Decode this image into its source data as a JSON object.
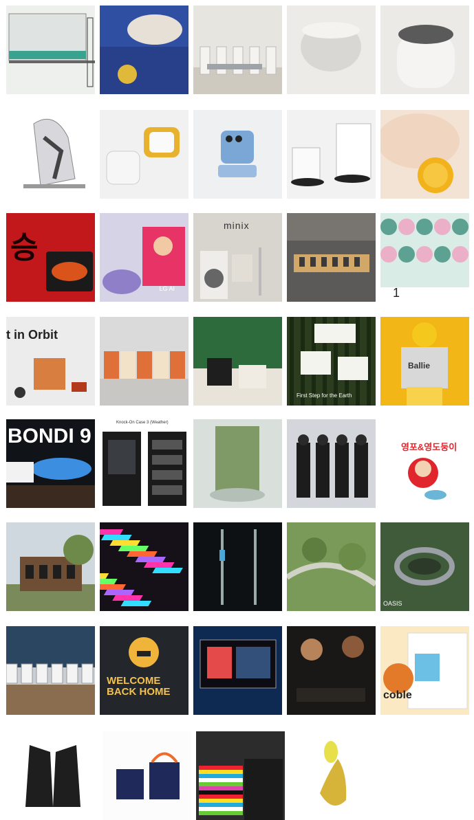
{
  "gallery": {
    "tiles": [
      {
        "id": "r1c1",
        "subject": "tv-stand-product",
        "bg": "#eef0ee",
        "accent": "#3aa38f"
      },
      {
        "id": "r1c2",
        "subject": "lifestyle-sofa-robot",
        "bg": "#2f4fa3",
        "accent": "#e0b83a"
      },
      {
        "id": "r1c3",
        "subject": "office-interior",
        "bg": "#e7e5df",
        "accent": "#9aa0a5"
      },
      {
        "id": "r1c4",
        "subject": "white-speaker",
        "bg": "#ecebe8",
        "accent": "#cfcdca"
      },
      {
        "id": "r1c5",
        "subject": "grey-speaker-top",
        "bg": "#eceae6",
        "accent": "#5a5a5a"
      },
      {
        "id": "r2c1",
        "subject": "massage-chair",
        "bg": "#ffffff",
        "accent": "#a8a8ad"
      },
      {
        "id": "r2c2",
        "subject": "robot-cubes",
        "bg": "#f1f1f1",
        "accent": "#e9b22e"
      },
      {
        "id": "r2c3",
        "subject": "flip-phone",
        "bg": "#eef0f2",
        "accent": "#7aa7d6"
      },
      {
        "id": "r2c4",
        "subject": "robot-vacuums",
        "bg": "#f2f2f2",
        "accent": "#222222"
      },
      {
        "id": "r2c5",
        "subject": "baby-pacifier",
        "bg": "#f3e3d4",
        "accent": "#f2b21b"
      },
      {
        "id": "r3c1",
        "subject": "red-food-box",
        "bg": "#c2171b",
        "accent": "#1a1a1a",
        "caption": "승"
      },
      {
        "id": "r3c2",
        "subject": "ai-speaker-avatar",
        "bg": "#d6d3e6",
        "accent": "#c8305a",
        "caption": "LG AI"
      },
      {
        "id": "r3c3",
        "subject": "minix-appliances",
        "bg": "#d8d5cf",
        "accent": "#4a4a4a",
        "caption": "minix"
      },
      {
        "id": "r3c4",
        "subject": "display-table",
        "bg": "#5c5a58",
        "accent": "#d2a868"
      },
      {
        "id": "r3c5",
        "subject": "illustrated-calendar",
        "bg": "#eaf3ef",
        "accent": "#3c8e7c",
        "caption": "1"
      },
      {
        "id": "r4c1",
        "subject": "in-orbit-objects",
        "bg": "#ececec",
        "accent": "#d66b23",
        "caption": "t in Orbit"
      },
      {
        "id": "r4c2",
        "subject": "product-boxes",
        "bg": "#dadada",
        "accent": "#e0703a"
      },
      {
        "id": "r4c3",
        "subject": "green-packaging",
        "bg": "#2e6b3c",
        "accent": "#f0ece4"
      },
      {
        "id": "r4c4",
        "subject": "forest-boxes",
        "bg": "#2b3d1e",
        "accent": "#e8eb6a",
        "caption": "First Step for the Earth"
      },
      {
        "id": "r4c5",
        "subject": "ballie-box",
        "bg": "#f2b716",
        "accent": "#ffffff",
        "caption": "Ballie"
      },
      {
        "id": "r5c1",
        "subject": "bondi-shoe-billboard",
        "bg": "#101318",
        "accent": "#3b8ee0",
        "caption": "BONDI 9"
      },
      {
        "id": "r5c2",
        "subject": "knock-on-case",
        "bg": "#ffffff",
        "accent": "#222222",
        "caption": "Knock-On Case 3 (Weather)"
      },
      {
        "id": "r5c3",
        "subject": "green-cylinder-room",
        "bg": "#d9dfdb",
        "accent": "#6e8d52"
      },
      {
        "id": "r5c4",
        "subject": "fashion-poster",
        "bg": "#d3d6da",
        "accent": "#1c1c1c"
      },
      {
        "id": "r5c5",
        "subject": "character-illustration",
        "bg": "#ffffff",
        "accent": "#e0262c",
        "caption": "영포&영도둥이"
      },
      {
        "id": "r6c1",
        "subject": "brick-building",
        "bg": "#cfd8df",
        "accent": "#6f4e36"
      },
      {
        "id": "r6c2",
        "subject": "neon-installation",
        "bg": "#161018",
        "accent": "#e7357f"
      },
      {
        "id": "r6c3",
        "subject": "street-lamps",
        "bg": "#0e1114",
        "accent": "#4aa7d8"
      },
      {
        "id": "r6c4",
        "subject": "aerial-park",
        "bg": "#7a9a5a",
        "accent": "#cfd2c4"
      },
      {
        "id": "r6c5",
        "subject": "circular-pavilion",
        "bg": "#3f5b3a",
        "accent": "#9aa0a6",
        "caption": "OASIS"
      },
      {
        "id": "r7c1",
        "subject": "airport-lounge",
        "bg": "#c9cfd5",
        "accent": "#8a6d4f"
      },
      {
        "id": "r7c2",
        "subject": "welcome-back-home",
        "bg": "#23262b",
        "accent": "#e8a62a",
        "caption": "WELCOME BACK HOME"
      },
      {
        "id": "r7c3",
        "subject": "tv-screens",
        "bg": "#0f2a52",
        "accent": "#e54a4a"
      },
      {
        "id": "r7c4",
        "subject": "dining-couple",
        "bg": "#1a1816",
        "accent": "#b7835a"
      },
      {
        "id": "r7c5",
        "subject": "kids-coding-app",
        "bg": "#fbe9c4",
        "accent": "#e27a2a",
        "caption": "coble"
      },
      {
        "id": "r8c1",
        "subject": "black-vest",
        "bg": "#ffffff",
        "accent": "#1e1e1e"
      },
      {
        "id": "r8c2",
        "subject": "tote-bags",
        "bg": "#5ca8de",
        "accent": "#ef6b2b"
      },
      {
        "id": "r8c3",
        "subject": "striped-bag",
        "bg": "#2c2c2c",
        "accent": "#d8417a"
      },
      {
        "id": "r8c4",
        "subject": "golden-sculpture",
        "bg": "#ffffff",
        "accent": "#d6b43a"
      }
    ]
  }
}
